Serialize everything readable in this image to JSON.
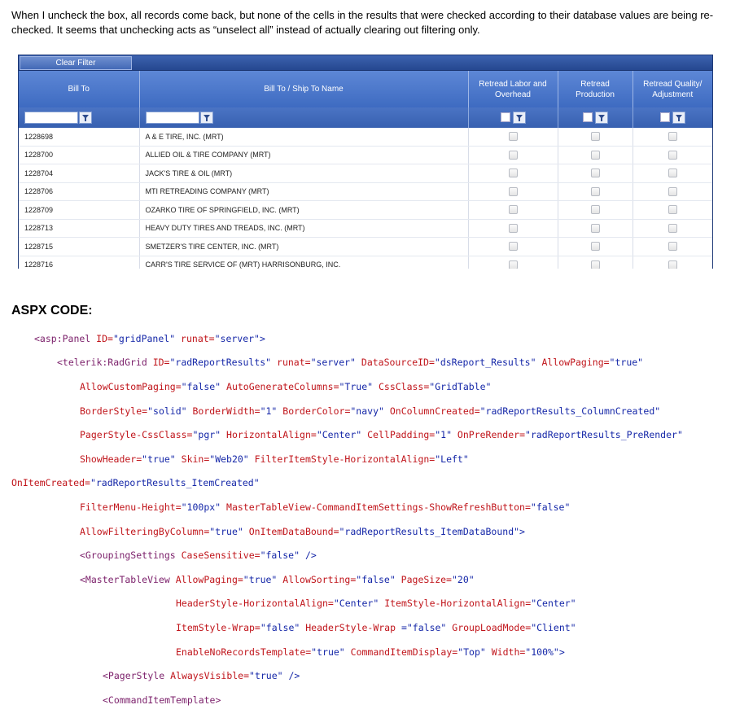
{
  "intro_text": "When I uncheck the box, all records come back, but none of the cells in the results that were checked according to their database values are being re-checked.  It seems that unchecking acts as “unselect all” instead of actually clearing out filtering only.",
  "grid": {
    "clear_filter_label": "Clear Filter",
    "columns": [
      "Bill To",
      "Bill To / Ship To Name",
      "Retread Labor and Overhead",
      "Retread Production",
      "Retread Quality/ Adjustment"
    ],
    "rows": [
      {
        "bill_to": "1228698",
        "name": "A & E TIRE, INC. (MRT)"
      },
      {
        "bill_to": "1228700",
        "name": "ALLIED OIL & TIRE COMPANY (MRT)"
      },
      {
        "bill_to": "1228704",
        "name": "JACK'S TIRE & OIL (MRT)"
      },
      {
        "bill_to": "1228706",
        "name": "MTI RETREADING COMPANY (MRT)"
      },
      {
        "bill_to": "1228709",
        "name": "OZARKO TIRE OF SPRINGFIELD, INC. (MRT)"
      },
      {
        "bill_to": "1228713",
        "name": "HEAVY DUTY TIRES AND TREADS, INC. (MRT)"
      },
      {
        "bill_to": "1228715",
        "name": "SMETZER'S TIRE CENTER, INC. (MRT)"
      },
      {
        "bill_to": "1228716",
        "name": "CARR'S TIRE SERVICE OF (MRT) HARRISONBURG, INC."
      }
    ]
  },
  "aspx_title": "ASPX CODE:",
  "code": {
    "l1": [
      "<asp:Panel ",
      "ID=",
      "\"gridPanel\"",
      " runat=",
      "\"server\">"
    ],
    "l2": [
      "<telerik:RadGrid ",
      "ID=",
      "\"radReportResults\"",
      " runat=",
      "\"server\"",
      " DataSourceID=",
      "\"dsReport_Results\"",
      " AllowPaging=",
      "\"true\""
    ],
    "l3": [
      "AllowCustomPaging=",
      "\"false\"",
      " AutoGenerateColumns=",
      "\"True\"",
      " CssClass=",
      "\"GridTable\""
    ],
    "l4": [
      "BorderStyle=",
      "\"solid\"",
      " BorderWidth=",
      "\"1\"",
      " BorderColor=",
      "\"navy\"",
      " OnColumnCreated=",
      "\"radReportResults_ColumnCreated\""
    ],
    "l5": [
      "PagerStyle-CssClass=",
      "\"pgr\"",
      " HorizontalAlign=",
      "\"Center\"",
      " CellPadding=",
      "\"1\"",
      " OnPreRender=",
      "\"radReportResults_PreRender\""
    ],
    "l6": [
      "ShowHeader=",
      "\"true\"",
      " Skin=",
      "\"Web20\"",
      " FilterItemStyle-HorizontalAlign=",
      "\"Left\""
    ],
    "l7": [
      "OnItemCreated=",
      "\"radReportResults_ItemCreated\""
    ],
    "l8": [
      "FilterMenu-Height=",
      "\"100px\"",
      " MasterTableView-CommandItemSettings-ShowRefreshButton=",
      "\"false\""
    ],
    "l9": [
      "AllowFilteringByColumn=",
      "\"true\"",
      " OnItemDataBound=",
      "\"radReportResults_ItemDataBound\">"
    ],
    "l10": [
      "<GroupingSettings ",
      "CaseSensitive=",
      "\"false\"",
      " />"
    ],
    "l11": [
      "<MasterTableView ",
      "AllowPaging=",
      "\"true\"",
      " AllowSorting=",
      "\"false\"",
      " PageSize=",
      "\"20\""
    ],
    "l12": [
      "HeaderStyle-HorizontalAlign=",
      "\"Center\"",
      " ItemStyle-HorizontalAlign=",
      "\"Center\""
    ],
    "l13": [
      "ItemStyle-Wrap=",
      "\"false\"",
      " HeaderStyle-Wrap ",
      "=\"false\"",
      " GroupLoadMode=",
      "\"Client\""
    ],
    "l14": [
      "EnableNoRecordsTemplate=",
      "\"true\"",
      " CommandItemDisplay=",
      "\"Top\"",
      " Width=",
      "\"100%\">"
    ],
    "l15": [
      "<PagerStyle ",
      "AlwaysVisible=",
      "\"true\"",
      " />"
    ],
    "l16": [
      "<CommandItemTemplate>"
    ]
  }
}
